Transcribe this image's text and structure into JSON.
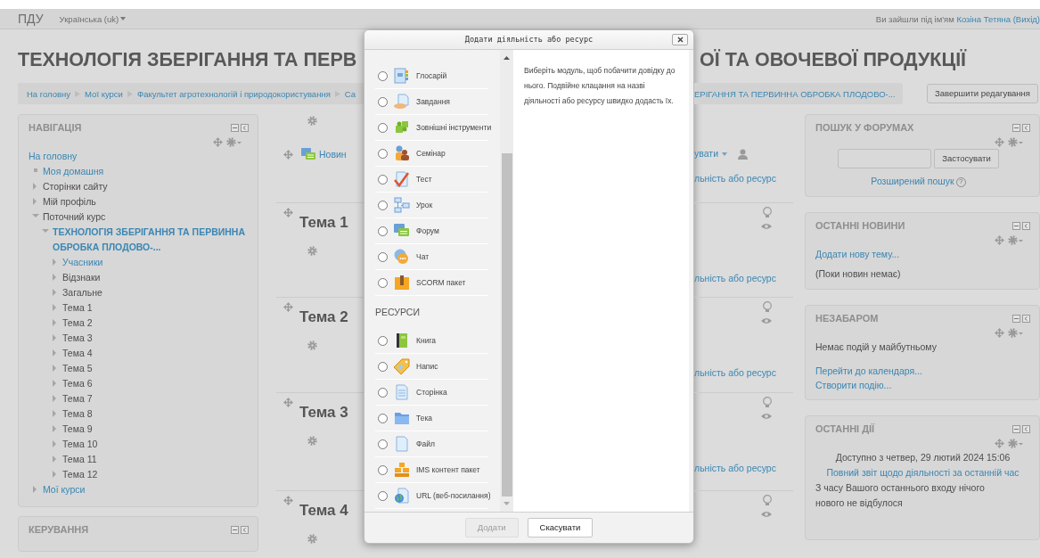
{
  "header": {
    "brand": "ПДУ",
    "language": "Українська (uk)",
    "login": {
      "prefix": "Ви зайшли під ім'ям",
      "user": "Козіна Тетяна",
      "logout": "(Вихід)"
    }
  },
  "course_title": {
    "left": "ТЕХНОЛОГІЯ ЗБЕРІГАННЯ ТА ПЕРВ",
    "right": "ОЇ ТА ОВОЧЕВОЇ ПРОДУКЦІЇ"
  },
  "breadcrumb": {
    "left": [
      "На головну",
      "Мої курси",
      "Факультет агротехнологій і природокористування",
      "Са"
    ],
    "right": "ЕРІГАННЯ ТА ПЕРВИННА ОБРОБКА ПЛОДОВО-..."
  },
  "edit_button": "Завершити редагування",
  "navigation": {
    "title": "НАВІГАЦІЯ",
    "items": [
      {
        "label": "На головну",
        "kind": "root",
        "link": true,
        "children": [
          {
            "label": "Моя домашня",
            "kind": "leaf",
            "link": true
          },
          {
            "label": "Сторінки сайту",
            "kind": "branch",
            "link": false,
            "expanded": false
          },
          {
            "label": "Мій профіль",
            "kind": "branch",
            "link": false,
            "expanded": false
          },
          {
            "label": "Поточний курс",
            "kind": "branch",
            "link": false,
            "expanded": true,
            "children": [
              {
                "label": "ТЕХНОЛОГІЯ ЗБЕРІГАННЯ ТА ПЕРВИННА ОБРОБКА ПЛОДОВО-...",
                "kind": "course",
                "link": true,
                "expanded": true,
                "children": [
                  {
                    "label": "Учасники",
                    "kind": "branch",
                    "link": true,
                    "expanded": false
                  },
                  {
                    "label": "Відзнаки",
                    "kind": "branch",
                    "link": false,
                    "expanded": false
                  },
                  {
                    "label": "Загальне",
                    "kind": "branch",
                    "link": false,
                    "expanded": false
                  },
                  {
                    "label": "Тема 1",
                    "kind": "branch",
                    "link": false,
                    "expanded": false
                  },
                  {
                    "label": "Тема 2",
                    "kind": "branch",
                    "link": false,
                    "expanded": false
                  },
                  {
                    "label": "Тема 3",
                    "kind": "branch",
                    "link": false,
                    "expanded": false
                  },
                  {
                    "label": "Тема 4",
                    "kind": "branch",
                    "link": false,
                    "expanded": false
                  },
                  {
                    "label": "Тема 5",
                    "kind": "branch",
                    "link": false,
                    "expanded": false
                  },
                  {
                    "label": "Тема 6",
                    "kind": "branch",
                    "link": false,
                    "expanded": false
                  },
                  {
                    "label": "Тема 7",
                    "kind": "branch",
                    "link": false,
                    "expanded": false
                  },
                  {
                    "label": "Тема 8",
                    "kind": "branch",
                    "link": false,
                    "expanded": false
                  },
                  {
                    "label": "Тема 9",
                    "kind": "branch",
                    "link": false,
                    "expanded": false
                  },
                  {
                    "label": "Тема 10",
                    "kind": "branch",
                    "link": false,
                    "expanded": false
                  },
                  {
                    "label": "Тема 11",
                    "kind": "branch",
                    "link": false,
                    "expanded": false
                  },
                  {
                    "label": "Тема 12",
                    "kind": "branch",
                    "link": false,
                    "expanded": false
                  }
                ]
              }
            ]
          },
          {
            "label": "Мої курси",
            "kind": "branch",
            "link": true,
            "expanded": false
          }
        ]
      }
    ]
  },
  "admin_block": {
    "title": "КЕРУВАННЯ"
  },
  "course": {
    "top": {
      "activity_left": "Новин",
      "activity_right": "увати",
      "add_link": "льність або ресурс"
    },
    "sections": [
      {
        "title": "Тема 1",
        "add_link": "льність або ресурс"
      },
      {
        "title": "Тема 2",
        "add_link": "льність або ресурс"
      },
      {
        "title": "Тема 3",
        "add_link": "льність або ресурс"
      },
      {
        "title": "Тема 4"
      }
    ]
  },
  "modal": {
    "title": "Додати діяльність або ресурс",
    "activities": [
      {
        "label": "Глосарій",
        "selected": false
      },
      {
        "label": "Завдання",
        "selected": false
      },
      {
        "label": "Зовнішні інструменти",
        "selected": false
      },
      {
        "label": "Семінар",
        "selected": false
      },
      {
        "label": "Тест",
        "selected": false
      },
      {
        "label": "Урок",
        "selected": false
      },
      {
        "label": "Форум",
        "selected": false
      },
      {
        "label": "Чат",
        "selected": false
      },
      {
        "label": "SCORM пакет",
        "selected": false
      }
    ],
    "resources": {
      "heading": "РЕСУРСИ",
      "items": [
        {
          "label": "Книга",
          "selected": false
        },
        {
          "label": "Напис",
          "selected": false
        },
        {
          "label": "Сторінка",
          "selected": false
        },
        {
          "label": "Тека",
          "selected": false
        },
        {
          "label": "Файл",
          "selected": false
        },
        {
          "label": "IMS контент пакет",
          "selected": false
        },
        {
          "label": "URL (веб-посилання)",
          "selected": false
        }
      ]
    },
    "help": "Виберіть модуль, щоб побачити довідку до нього. Подвійне клацання на назві діяльності або ресурсу швидко додасть їх.",
    "buttons": [
      {
        "label": "Додати",
        "disabled": true
      },
      {
        "label": "Скасувати",
        "disabled": false
      }
    ]
  },
  "forum_search": {
    "title": "ПОШУК У ФОРУМАХ",
    "button": "Застосувати",
    "advanced": "Розширений пошук",
    "help_mark": "?"
  },
  "news": {
    "title": "ОСТАННІ НОВИНИ",
    "add": "Додати нову тему...",
    "empty": "(Поки новин немає)"
  },
  "upcoming": {
    "title": "НЕЗАБАРОМ",
    "empty": "Немає подій у майбутньому",
    "links": [
      "Перейти до календаря...",
      "Створити подію..."
    ]
  },
  "recent": {
    "title": "ОСТАННІ ДІЇ",
    "since": "Доступно з четвер, 29 лютий 2024 15:06",
    "report": "Повний звіт щодо діяльності за останній час",
    "note": "З часу Вашого останнього входу нічого нового не відбулося"
  }
}
